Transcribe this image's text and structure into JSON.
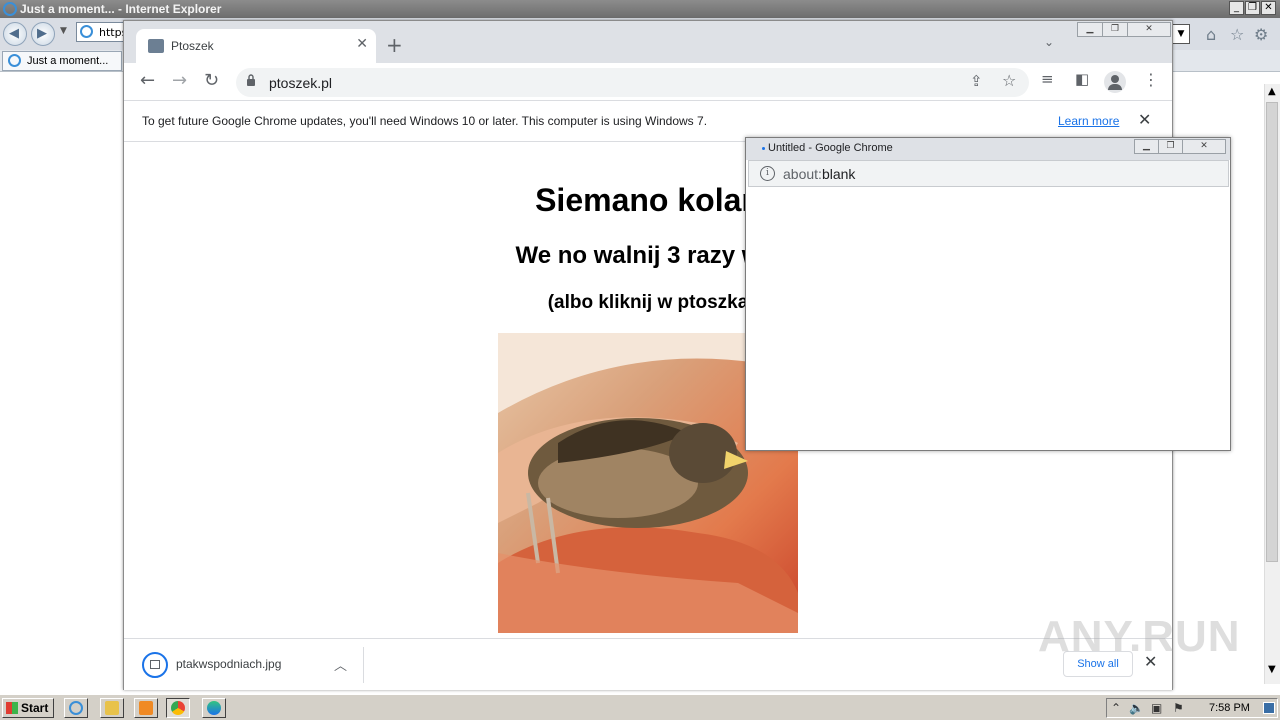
{
  "ie": {
    "window_title": "Just a moment... - Internet Explorer",
    "address_fragment": "https:",
    "tab_label": "Just a moment..."
  },
  "chrome": {
    "tab_title": "Ptoszek",
    "url": "ptoszek.pl",
    "infobar_message": "To get future Google Chrome updates, you'll need Windows 10 or later. This computer is using Windows 7.",
    "infobar_link": "Learn more",
    "page": {
      "heading1": "Siemano kolan",
      "heading2": "We no walnij 3 razy w s",
      "heading3": "(albo kliknij w ptoszka"
    },
    "download": {
      "filename": "ptakwspodniach.jpg",
      "show_all_label": "Show all"
    }
  },
  "popup": {
    "title": "Untitled - Google Chrome",
    "url_scheme": "about:",
    "url_path": "blank"
  },
  "watermark": "ANY.RUN",
  "taskbar": {
    "start_label": "Start",
    "clock": "7:58 PM"
  },
  "colors": {
    "chrome_frame": "#dee1e6",
    "link_blue": "#1a73e8",
    "taskbar": "#d4d0c8"
  }
}
